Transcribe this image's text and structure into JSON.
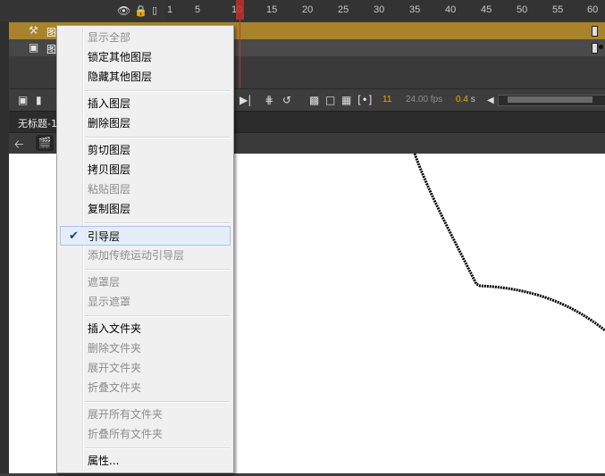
{
  "timeline": {
    "frame_ticks": [
      "1",
      "5",
      "10",
      "15",
      "20",
      "25",
      "30",
      "35",
      "40",
      "45",
      "50",
      "55",
      "60"
    ],
    "current_frame": "11",
    "fps": "24.00 fps",
    "seconds": "0.4",
    "seconds_unit": "s",
    "layers": [
      {
        "name": "图层",
        "icon": "guide-layer-icon",
        "state": "selected"
      },
      {
        "name": "图层",
        "icon": "layer-icon",
        "state": "normal"
      }
    ]
  },
  "document": {
    "tab_title": "无标题-1"
  },
  "context_menu": {
    "items": [
      {
        "label": "显示全部",
        "enabled": false
      },
      {
        "label": "锁定其他图层",
        "enabled": true
      },
      {
        "label": "隐藏其他图层",
        "enabled": true
      },
      {
        "label": "插入图层",
        "enabled": true
      },
      {
        "label": "删除图层",
        "enabled": true
      },
      {
        "label": "剪切图层",
        "enabled": true
      },
      {
        "label": "拷贝图层",
        "enabled": true
      },
      {
        "label": "粘贴图层",
        "enabled": false
      },
      {
        "label": "复制图层",
        "enabled": true
      },
      {
        "label": "引导层",
        "enabled": true,
        "checked": true,
        "highlighted": true
      },
      {
        "label": "添加传统运动引导层",
        "enabled": false
      },
      {
        "label": "遮罩层",
        "enabled": false
      },
      {
        "label": "显示遮罩",
        "enabled": false
      },
      {
        "label": "插入文件夹",
        "enabled": true
      },
      {
        "label": "删除文件夹",
        "enabled": false
      },
      {
        "label": "展开文件夹",
        "enabled": false
      },
      {
        "label": "折叠文件夹",
        "enabled": false
      },
      {
        "label": "展开所有文件夹",
        "enabled": false
      },
      {
        "label": "折叠所有文件夹",
        "enabled": false
      },
      {
        "label": "属性...",
        "enabled": true
      }
    ]
  },
  "colors": {
    "selected_layer": "#a8832a",
    "playhead": "#c0302d",
    "frame_number": "#e6b200",
    "menu_check": "#1a3c7c"
  }
}
